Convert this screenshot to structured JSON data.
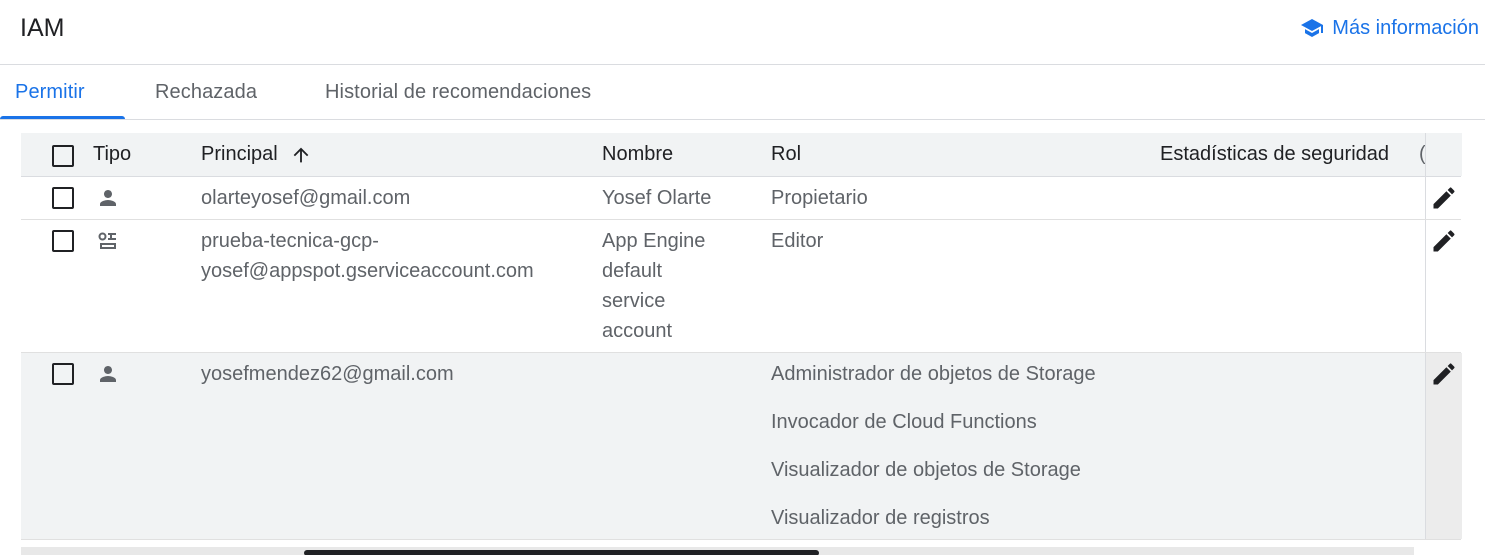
{
  "header": {
    "title": "IAM",
    "learn_more": "Más información",
    "learn_icon": "school-icon",
    "accent": "#1a73e8"
  },
  "tabs": [
    {
      "label": "Permitir",
      "active": true
    },
    {
      "label": "Rechazada",
      "active": false
    },
    {
      "label": "Historial de recomendaciones",
      "active": false
    }
  ],
  "table": {
    "columns": {
      "type": "Tipo",
      "principal": "Principal",
      "principal_sort_icon": "arrow-up-icon",
      "name": "Nombre",
      "role": "Rol",
      "security": "Estadísticas de seguridad",
      "security_truncated": "("
    },
    "rows": [
      {
        "type_icon": "person-icon",
        "principal": "olarteyosef@gmail.com",
        "name": "Yosef Olarte",
        "roles": [
          "Propietario"
        ]
      },
      {
        "type_icon": "service-account-icon",
        "principal_line1": "prueba-tecnica-gcp-",
        "principal_line2": "yosef@appspot.gserviceaccount.com",
        "name_lines": [
          "App Engine",
          "default",
          "service",
          "account"
        ],
        "roles": [
          "Editor"
        ]
      },
      {
        "type_icon": "person-icon",
        "principal": "yosefmendez62@gmail.com",
        "name": "",
        "roles": [
          "Administrador de objetos de Storage",
          "Invocador de Cloud Functions",
          "Visualizador de objetos de Storage",
          "Visualizador de registros"
        ]
      }
    ]
  }
}
